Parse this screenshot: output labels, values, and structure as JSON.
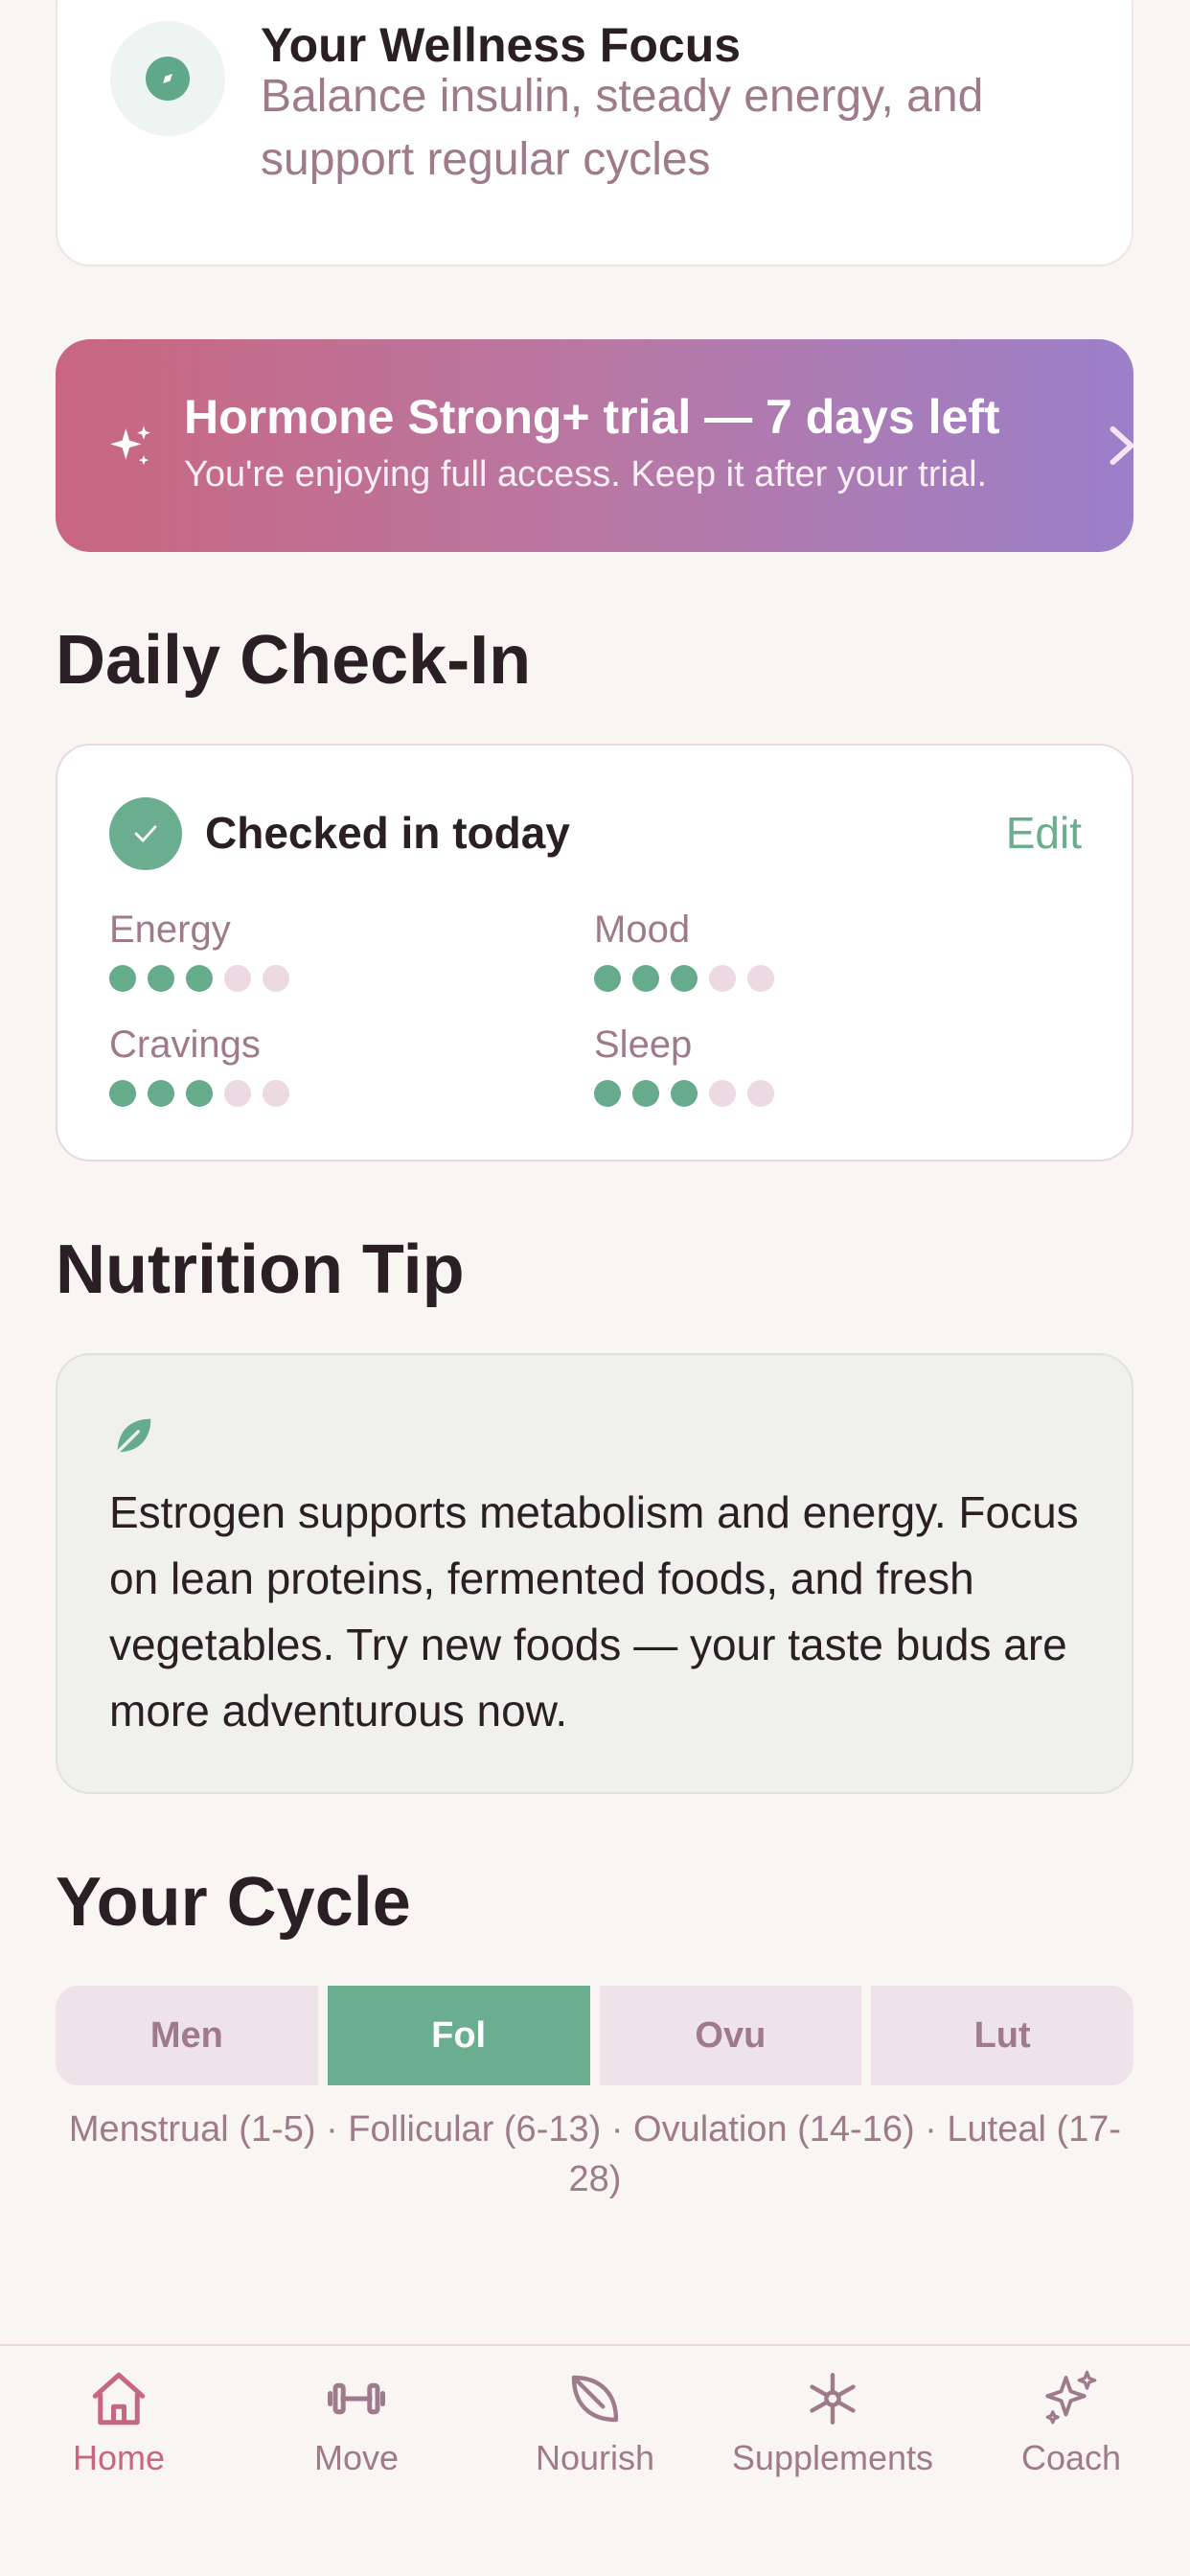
{
  "focus": {
    "title": "Your Wellness Focus",
    "subtitle": "Balance insulin, steady energy, and support regular cycles",
    "icon": "compass-icon"
  },
  "trial": {
    "title": "Hormone Strong+ trial — 7 days left",
    "subtitle": "You're enjoying full access. Keep it after your trial.",
    "icon": "sparkles-icon"
  },
  "checkin": {
    "section_title": "Daily Check-In",
    "status": "Checked in today",
    "edit_label": "Edit",
    "metrics": [
      {
        "label": "Energy",
        "value": 3,
        "max": 5
      },
      {
        "label": "Mood",
        "value": 3,
        "max": 5
      },
      {
        "label": "Cravings",
        "value": 3,
        "max": 5
      },
      {
        "label": "Sleep",
        "value": 3,
        "max": 5
      }
    ]
  },
  "nutrition": {
    "section_title": "Nutrition Tip",
    "icon": "leaf-icon",
    "text": "Estrogen supports metabolism and energy. Focus on lean proteins, fermented foods, and fresh vegetables. Try new foods — your taste buds are more adventurous now."
  },
  "cycle": {
    "section_title": "Your Cycle",
    "phases": [
      {
        "label": "Men",
        "active": false
      },
      {
        "label": "Fol",
        "active": true
      },
      {
        "label": "Ovu",
        "active": false
      },
      {
        "label": "Lut",
        "active": false
      }
    ],
    "legend": "Menstrual (1-5) · Follicular (6-13) · Ovulation (14-16) · Luteal (17-28)"
  },
  "nav": {
    "items": [
      {
        "label": "Home",
        "icon": "home-icon",
        "active": true
      },
      {
        "label": "Move",
        "icon": "dumbbell-icon",
        "active": false
      },
      {
        "label": "Nourish",
        "icon": "leaf-icon",
        "active": false
      },
      {
        "label": "Supplements",
        "icon": "asterisk-icon",
        "active": false
      },
      {
        "label": "Coach",
        "icon": "sparkles-icon",
        "active": false
      }
    ]
  },
  "colors": {
    "accent_green": "#6aae8f",
    "accent_pink": "#c9667f",
    "muted_text": "#9e7a8b",
    "background": "#f9f5f3"
  }
}
